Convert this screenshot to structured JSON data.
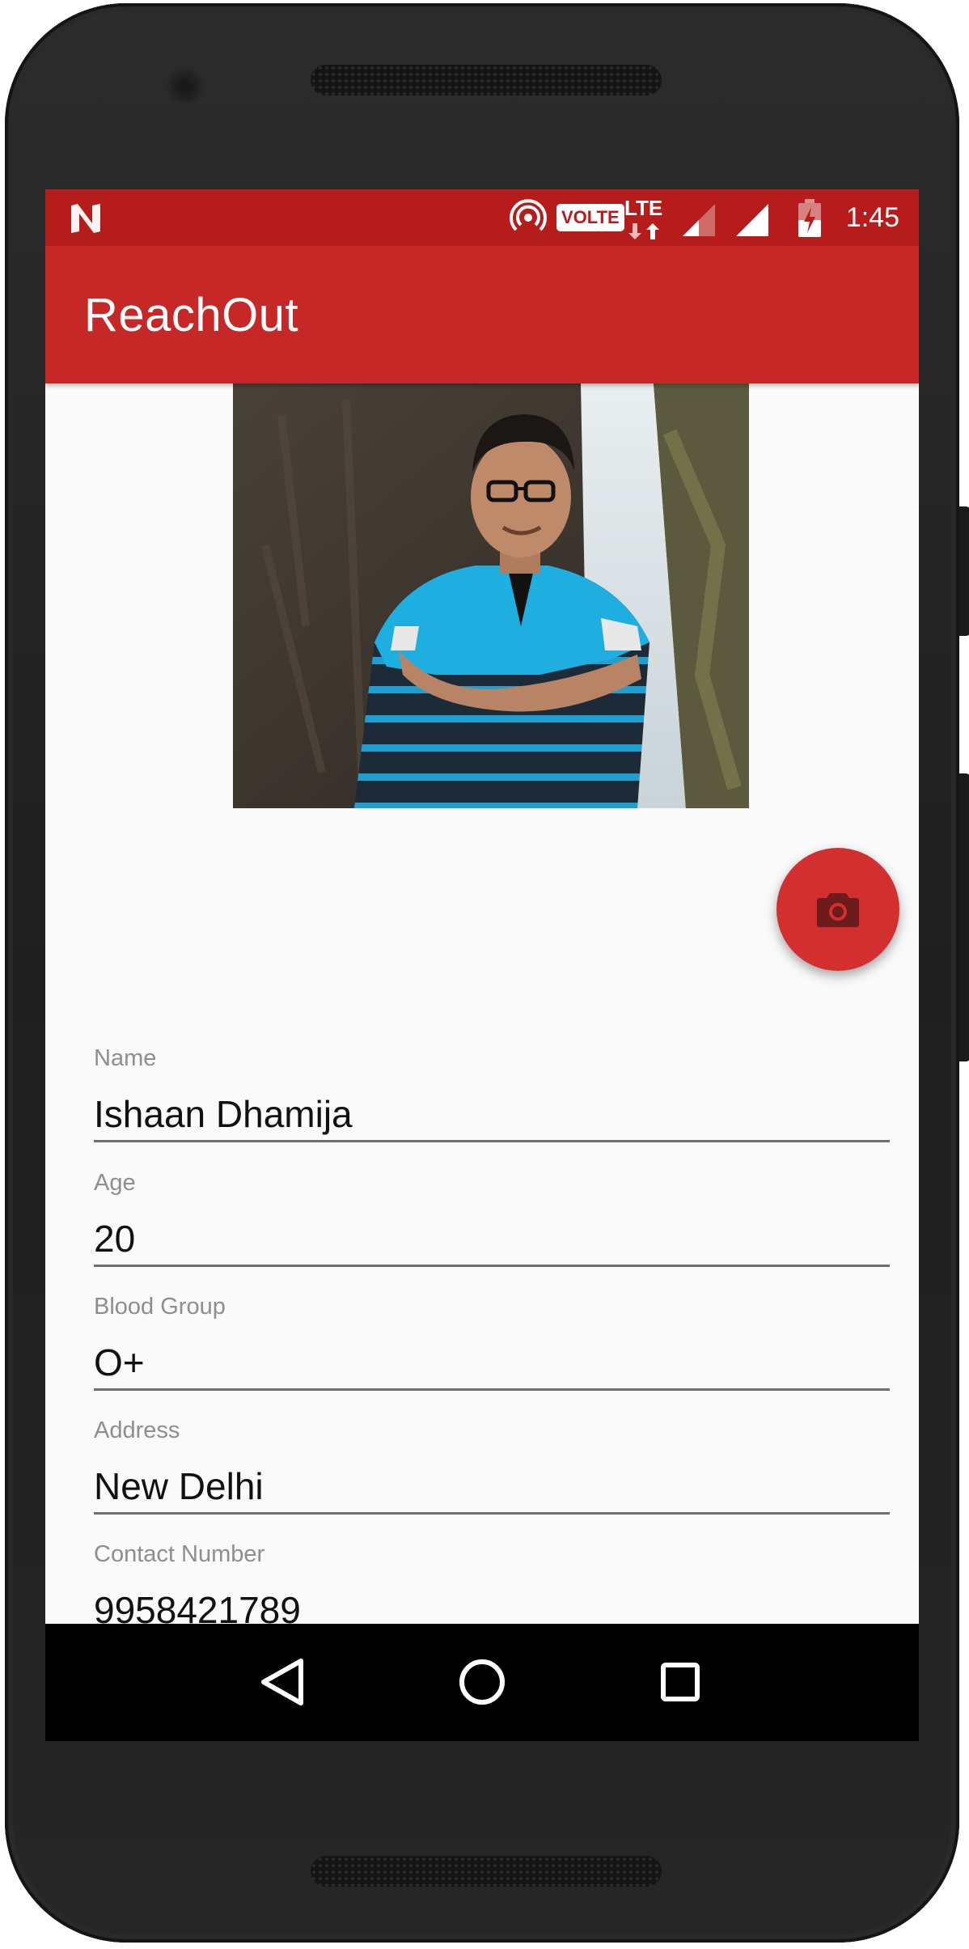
{
  "status_bar": {
    "time": "1:45",
    "volte_badge": "VOLTE",
    "lte_label": "LTE"
  },
  "app_bar": {
    "title": "ReachOut"
  },
  "profile": {
    "photo_alt": "Profile photo",
    "change_photo_icon": "camera-icon"
  },
  "form": {
    "fields": [
      {
        "label": "Name",
        "value": "Ishaan Dhamija"
      },
      {
        "label": "Age",
        "value": "20"
      },
      {
        "label": "Blood Group",
        "value": "O+"
      },
      {
        "label": "Address",
        "value": "New Delhi"
      },
      {
        "label": "Contact Number",
        "value": "9958421789"
      }
    ]
  },
  "nav_bar": {
    "back_icon": "back-triangle-icon",
    "home_icon": "home-circle-icon",
    "recents_icon": "recents-square-icon"
  },
  "colors": {
    "status_bar": "#b71c1c",
    "app_bar": "#c62828",
    "fab": "#d32f2f",
    "screen_background": "#fafafa"
  }
}
